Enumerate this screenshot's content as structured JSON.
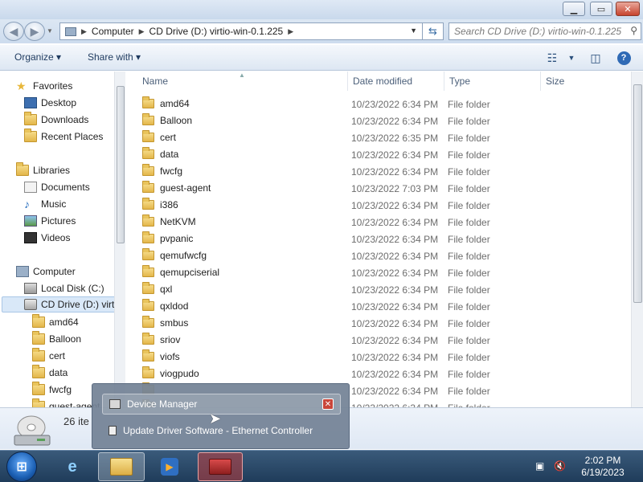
{
  "window": {
    "buttons": {
      "minimize": "▁",
      "maximize": "▭",
      "close": "✕"
    }
  },
  "address": {
    "crumbs": [
      "Computer",
      "CD Drive (D:) virtio-win-0.1.225"
    ],
    "search_placeholder": "Search CD Drive (D:) virtio-win-0.1.225"
  },
  "toolbar": {
    "organize_label": "Organize ▾",
    "share_label": "Share with ▾"
  },
  "nav": {
    "favorites": "Favorites",
    "desktop": "Desktop",
    "downloads": "Downloads",
    "recent": "Recent Places",
    "libraries": "Libraries",
    "documents": "Documents",
    "music": "Music",
    "pictures": "Pictures",
    "videos": "Videos",
    "computer": "Computer",
    "local_disk": "Local Disk (C:)",
    "cd_drive": "CD Drive (D:) virt",
    "sub": [
      "amd64",
      "Balloon",
      "cert",
      "data",
      "fwcfg",
      "guest-agent"
    ]
  },
  "columns": {
    "name": "Name",
    "date": "Date modified",
    "type": "Type",
    "size": "Size"
  },
  "files": [
    {
      "name": "amd64",
      "date": "10/23/2022 6:34 PM",
      "type": "File folder"
    },
    {
      "name": "Balloon",
      "date": "10/23/2022 6:34 PM",
      "type": "File folder"
    },
    {
      "name": "cert",
      "date": "10/23/2022 6:35 PM",
      "type": "File folder"
    },
    {
      "name": "data",
      "date": "10/23/2022 6:34 PM",
      "type": "File folder"
    },
    {
      "name": "fwcfg",
      "date": "10/23/2022 6:34 PM",
      "type": "File folder"
    },
    {
      "name": "guest-agent",
      "date": "10/23/2022 7:03 PM",
      "type": "File folder"
    },
    {
      "name": "i386",
      "date": "10/23/2022 6:34 PM",
      "type": "File folder"
    },
    {
      "name": "NetKVM",
      "date": "10/23/2022 6:34 PM",
      "type": "File folder"
    },
    {
      "name": "pvpanic",
      "date": "10/23/2022 6:34 PM",
      "type": "File folder"
    },
    {
      "name": "qemufwcfg",
      "date": "10/23/2022 6:34 PM",
      "type": "File folder"
    },
    {
      "name": "qemupciserial",
      "date": "10/23/2022 6:34 PM",
      "type": "File folder"
    },
    {
      "name": "qxl",
      "date": "10/23/2022 6:34 PM",
      "type": "File folder"
    },
    {
      "name": "qxldod",
      "date": "10/23/2022 6:34 PM",
      "type": "File folder"
    },
    {
      "name": "smbus",
      "date": "10/23/2022 6:34 PM",
      "type": "File folder"
    },
    {
      "name": "sriov",
      "date": "10/23/2022 6:34 PM",
      "type": "File folder"
    },
    {
      "name": "viofs",
      "date": "10/23/2022 6:34 PM",
      "type": "File folder"
    },
    {
      "name": "viogpudo",
      "date": "10/23/2022 6:34 PM",
      "type": "File folder"
    },
    {
      "name": "",
      "date": "10/23/2022 6:34 PM",
      "type": "File folder"
    },
    {
      "name": "",
      "date": "10/23/2022 6:34 PM",
      "type": "File folder"
    }
  ],
  "details": {
    "count": "26 ite"
  },
  "popup": {
    "title": "Device Manager",
    "item": "Update Driver Software - Ethernet Controller"
  },
  "clock": {
    "time": "2:02 PM",
    "date": "6/19/2023"
  }
}
